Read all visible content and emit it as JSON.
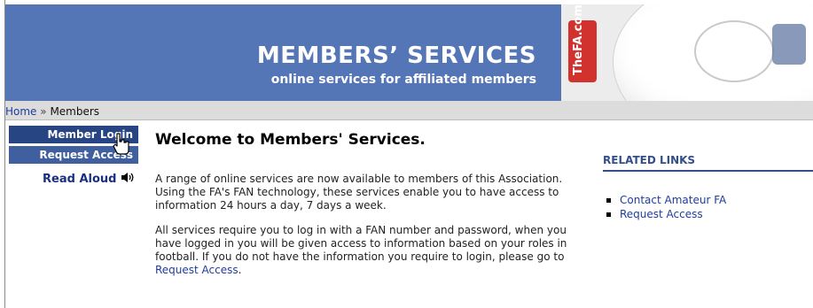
{
  "banner": {
    "title": "MEMBERS’ SERVICES",
    "subtitle": "online services for affiliated members",
    "logo_text": "TheFA.com"
  },
  "breadcrumb": {
    "home": "Home",
    "separator": "»",
    "current": "Members"
  },
  "nav": {
    "member_login": "Member Login",
    "request_access": "Request Access",
    "read_aloud": "Read Aloud"
  },
  "main": {
    "title": "Welcome to Members' Services.",
    "para1": "A range of online services are now available to members of this Association. Using the FA's FAN technology, these services enable you to have access to information 24 hours a day, 7 days a week.",
    "para2_text": "All services require you to log in with a FAN number and password, when you have logged in you will be given access to information based on your roles in football. If you do not have the information you require to login, please go to ",
    "para2_link": "Request Access",
    "para2_end": "."
  },
  "related": {
    "heading": "RELATED LINKS",
    "links": [
      "Contact Amateur FA",
      "Request Access"
    ]
  },
  "colors": {
    "banner": "#5576b6",
    "nav_button": "#3f5f9f",
    "link": "#1f3c9c",
    "logo_red": "#d1322e"
  },
  "icons": {
    "speaker": "speaker-icon",
    "cursor": "hand-pointer-icon"
  }
}
